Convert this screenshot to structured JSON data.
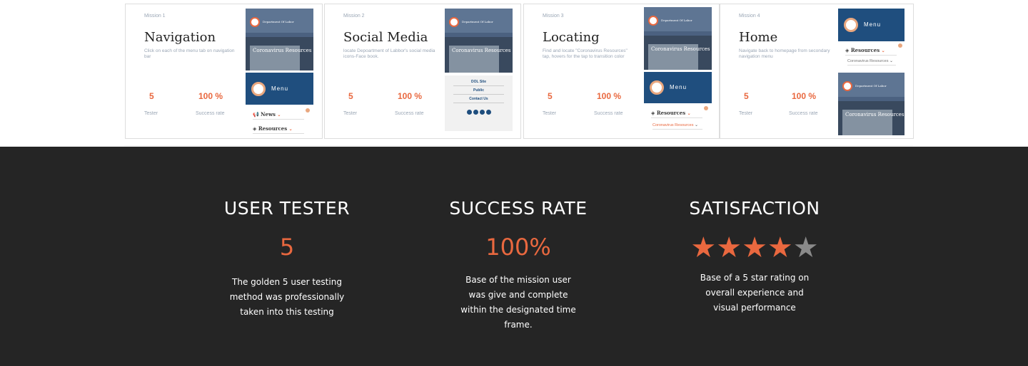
{
  "missions": [
    {
      "label": "Mission 1",
      "title": "Navigation",
      "desc": "Click on each of the menu tab on navigation bar",
      "tester_value": "5",
      "tester_label": "Tester",
      "rate_value": "100 %",
      "rate_label": "Success rate"
    },
    {
      "label": "Mission 2",
      "title": "Social Media",
      "desc": "locate Depoartment of Labbor's social media icons-Face book.",
      "tester_value": "5",
      "tester_label": "Tester",
      "rate_value": "100 %",
      "rate_label": "Success rate"
    },
    {
      "label": "Mission 3",
      "title": "Locating",
      "desc": "Find and locate \"Coronavirus Resources\" tap, hovers for the tap to transition color",
      "tester_value": "5",
      "tester_label": "Tester",
      "rate_value": "100 %",
      "rate_label": "Success rate"
    },
    {
      "label": "Mission 4",
      "title": "Home",
      "desc": "Navigate back to homepage from secondary navigation menu",
      "tester_value": "5",
      "tester_label": "Tester",
      "rate_value": "100 %",
      "rate_label": "Success rate"
    }
  ],
  "mockup": {
    "dept_name": "Department Of Labor",
    "hero_title": "Coronavirus Resources",
    "menu_label": "Menu",
    "news_label": "News",
    "resources_label": "Resources",
    "coronavirus_label": "Coronavirus Resources",
    "social_rows": [
      "DOL Site",
      "Public",
      "Contact Us"
    ]
  },
  "metrics": [
    {
      "title": "USER TESTER",
      "value": "5",
      "desc": "The golden 5 user testing method was professionally taken into this testing"
    },
    {
      "title": "SUCCESS RATE",
      "value": "100%",
      "desc": "Base of the mission user was give and complete within the designated  time frame."
    },
    {
      "title": "SATISFACTION",
      "rating": 4,
      "rating_max": 5,
      "desc": "Base of a 5 star rating on overall experience and visual performance"
    }
  ],
  "colors": {
    "accent": "#e9683f",
    "star_off": "#8a8a8a",
    "dark_bg": "#252525",
    "navy": "#1f4e7e"
  }
}
